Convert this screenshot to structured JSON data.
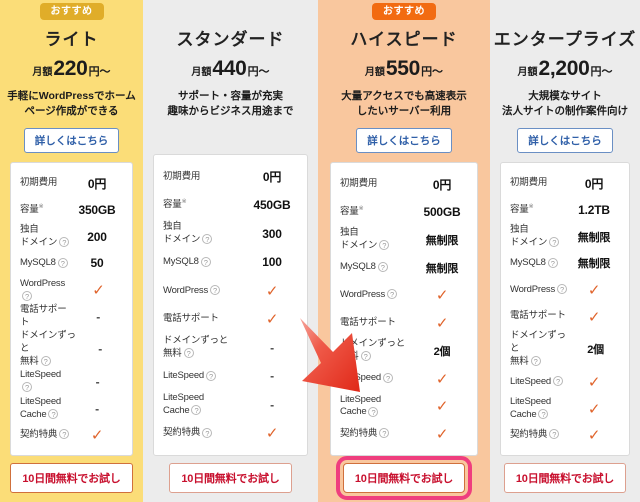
{
  "table": {
    "recommended_badge": "おすすめ",
    "more_link_label": "詳しくはこちら",
    "cta_label": "10日間無料でお試し",
    "price_prefix": "月額",
    "price_suffix": "円～",
    "help_icon": "question-mark-icon",
    "arrow_annotation": {
      "name": "red-arrow-annotation",
      "color": "#e8352b",
      "points_to": "cta-button-highspeed"
    },
    "highlight_ring_color": "#ef3e7e",
    "feature_labels": [
      "初期費用",
      "容量",
      "独自\nドメイン",
      "MySQL8",
      "WordPress",
      "電話サポート",
      "ドメインずっと\n無料",
      "LiteSpeed",
      "LiteSpeed\nCache",
      "契約特典"
    ],
    "plans": [
      {
        "id": "light",
        "name": "ライト",
        "badge": "おすすめ",
        "badge_style": "gold",
        "bg_color": "#fbdd78",
        "price": "220",
        "desc_line1": "手軽にWordPressでホーム",
        "desc_line2": "ページ作成ができる",
        "has_more_link": true,
        "values": [
          "0円",
          "350GB",
          "200",
          "50",
          "✓",
          "-",
          "-",
          "-",
          "-",
          "✓"
        ],
        "cta_highlighted": false
      },
      {
        "id": "standard",
        "name": "スタンダード",
        "badge": null,
        "badge_style": "none",
        "bg_color": "#ececec",
        "price": "440",
        "desc_line1": "サポート・容量が充実",
        "desc_line2": "趣味からビジネス用途まで",
        "has_more_link": false,
        "values": [
          "0円",
          "450GB",
          "300",
          "100",
          "✓",
          "✓",
          "-",
          "-",
          "-",
          "✓"
        ],
        "cta_highlighted": false
      },
      {
        "id": "highspeed",
        "name": "ハイスピード",
        "badge": "おすすめ",
        "badge_style": "orange",
        "bg_color": "#f9c79e",
        "price": "550",
        "desc_line1": "大量アクセスでも高速表示",
        "desc_line2": "したいサーバー利用",
        "has_more_link": true,
        "values": [
          "0円",
          "500GB",
          "無制限",
          "無制限",
          "✓",
          "✓",
          "2個",
          "✓",
          "✓",
          "✓"
        ],
        "cta_highlighted": true
      },
      {
        "id": "enterprise",
        "name": "エンタープライズ",
        "badge": null,
        "badge_style": "none",
        "bg_color": "#ececec",
        "price": "2,200",
        "desc_line1": "大規模なサイト",
        "desc_line2": "法人サイトの制作案件向け",
        "has_more_link": true,
        "values": [
          "0円",
          "1.2TB",
          "無制限",
          "無制限",
          "✓",
          "✓",
          "2個",
          "✓",
          "✓",
          "✓"
        ],
        "cta_highlighted": false
      }
    ]
  }
}
